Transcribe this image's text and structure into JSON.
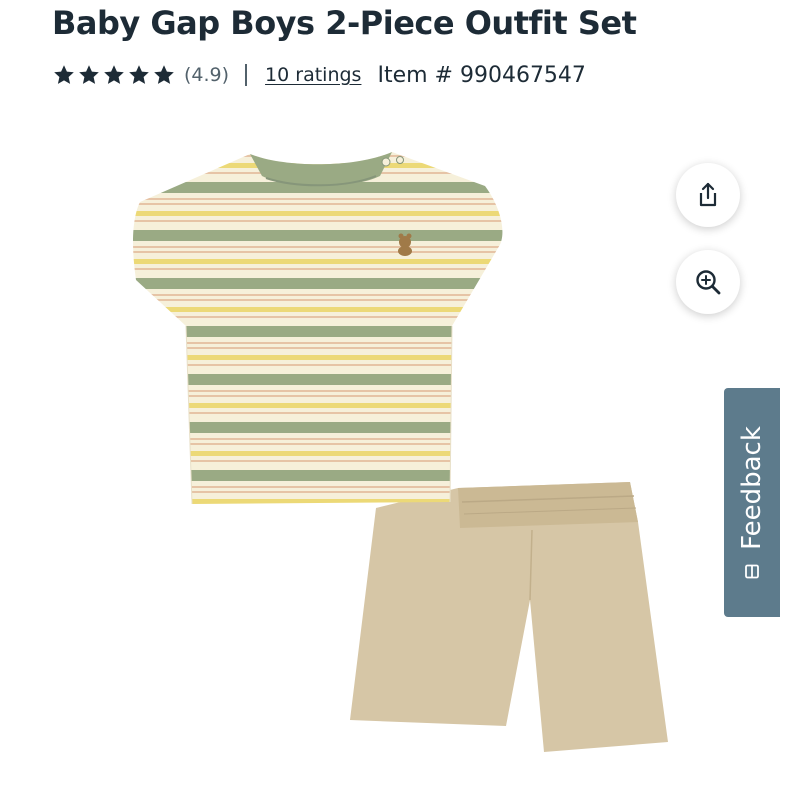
{
  "product": {
    "title": "Baby Gap Boys 2-Piece Outfit Set",
    "rating_stars": 5,
    "rating_text": "(4.9)",
    "ratings_link": "10 ratings",
    "item_number": "Item # 990467547"
  },
  "image": {
    "alt": "Striped green, yellow and cream tee with khaki shorts",
    "colors": {
      "stripe_green": "#9aaa84",
      "stripe_yellow": "#ecd977",
      "stripe_peach": "#e6c4a6",
      "cream": "#f6f0da",
      "khaki": "#d6c6a6"
    }
  },
  "actions": {
    "share_icon": "share-icon",
    "zoom_icon": "zoom-in-icon"
  },
  "feedback": {
    "label": "Feedback",
    "icon": "feedback-icon",
    "color": "#5d7b8c"
  }
}
